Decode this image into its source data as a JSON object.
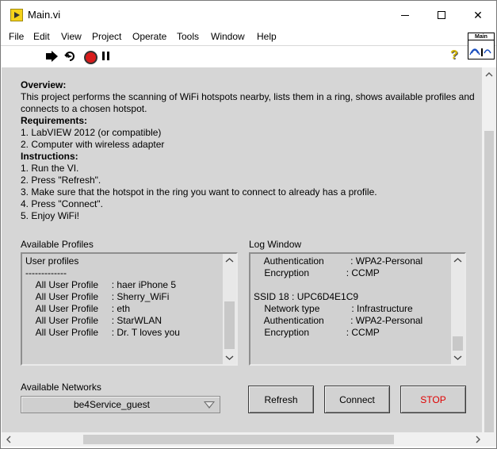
{
  "window": {
    "title": "Main.vi",
    "close_glyph": "✕"
  },
  "menu": [
    "File",
    "Edit",
    "View",
    "Project",
    "Operate",
    "Tools",
    "Window",
    "Help"
  ],
  "toolbar": {
    "help_glyph": "?"
  },
  "vi_icon": {
    "label": "Main"
  },
  "overview": {
    "overview_heading": "Overview",
    "overview_text": "This project performs the  scanning of WiFi hotspots nearby, lists them in a ring, shows available profiles and connects to a chosen hotspot.",
    "requirements_heading": "Requirements",
    "requirements": [
      "1. LabVIEW 2012 (or compatible)",
      "2. Computer with wireless adapter"
    ],
    "instructions_heading": "Instructions",
    "instructions": [
      "1. Run the VI.",
      "2. Press \"Refresh\".",
      "3. Make sure that the hotspot in the ring you want to connect to already has a profile.",
      "4. Press \"Connect\".",
      "5. Enjoy WiFi!"
    ]
  },
  "profiles": {
    "label": "Available Profiles",
    "text": "User profiles\n-------------\n    All User Profile     : haer iPhone 5\n    All User Profile     : Sherry_WiFi\n    All User Profile     : eth\n    All User Profile     : StarWLAN\n    All User Profile     : Dr. T loves you"
  },
  "log": {
    "label": "Log Window",
    "text": "    Authentication          : WPA2-Personal\n    Encryption              : CCMP\n\nSSID 18 : UPC6D4E1C9\n    Network type            : Infrastructure\n    Authentication          : WPA2-Personal\n    Encryption              : CCMP"
  },
  "networks": {
    "label": "Available Networks",
    "selected": "be4Service_guest"
  },
  "buttons": {
    "refresh": "Refresh",
    "connect": "Connect",
    "stop": "STOP"
  }
}
